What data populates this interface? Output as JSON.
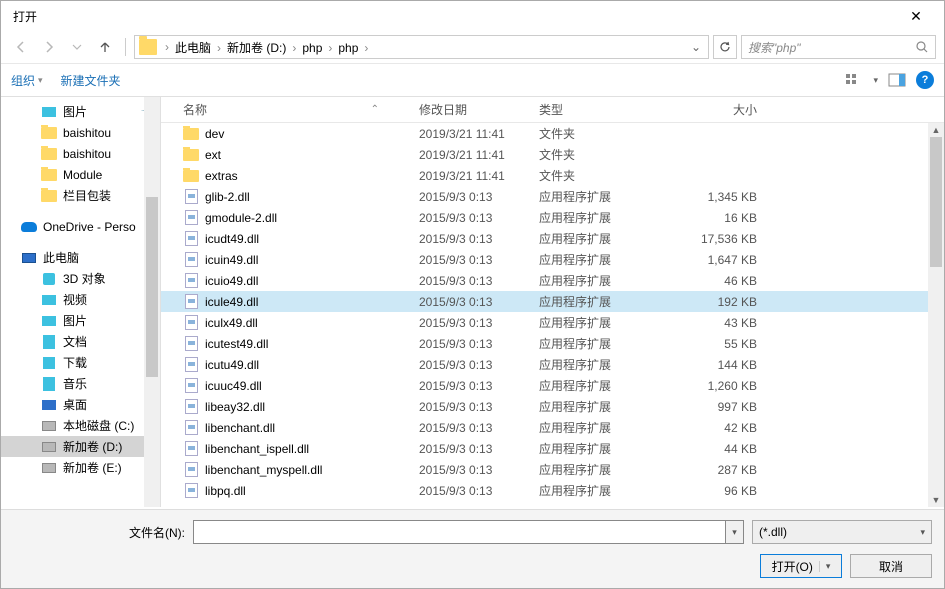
{
  "title": "打开",
  "breadcrumb": [
    "此电脑",
    "新加卷 (D:)",
    "php",
    "php"
  ],
  "search_placeholder": "搜索\"php\"",
  "toolbar": {
    "organize": "组织",
    "new_folder": "新建文件夹"
  },
  "sidebar": [
    {
      "icon": "pic",
      "label": "图片",
      "level": 2,
      "pin": true
    },
    {
      "icon": "folder",
      "label": "baishitou",
      "level": 2
    },
    {
      "icon": "folder",
      "label": "baishitou",
      "level": 2
    },
    {
      "icon": "folder",
      "label": "Module",
      "level": 2
    },
    {
      "icon": "folder",
      "label": "栏目包装",
      "level": 2
    },
    {
      "spacer": true
    },
    {
      "icon": "onedrive",
      "label": "OneDrive - Perso",
      "level": 1
    },
    {
      "spacer": true
    },
    {
      "icon": "pc",
      "label": "此电脑",
      "level": 1
    },
    {
      "icon": "3d",
      "label": "3D 对象",
      "level": 2
    },
    {
      "icon": "video",
      "label": "视频",
      "level": 2
    },
    {
      "icon": "pic",
      "label": "图片",
      "level": 2
    },
    {
      "icon": "doc",
      "label": "文档",
      "level": 2
    },
    {
      "icon": "down",
      "label": "下载",
      "level": 2
    },
    {
      "icon": "music",
      "label": "音乐",
      "level": 2
    },
    {
      "icon": "desktop",
      "label": "桌面",
      "level": 2
    },
    {
      "icon": "disk",
      "label": "本地磁盘 (C:)",
      "level": 2
    },
    {
      "icon": "disk",
      "label": "新加卷 (D:)",
      "level": 2,
      "selected": true
    },
    {
      "icon": "disk",
      "label": "新加卷 (E:)",
      "level": 2
    }
  ],
  "columns": {
    "name": "名称",
    "date": "修改日期",
    "type": "类型",
    "size": "大小"
  },
  "files": [
    {
      "icon": "folder",
      "name": "dev",
      "date": "2019/3/21 11:41",
      "type": "文件夹",
      "size": ""
    },
    {
      "icon": "folder",
      "name": "ext",
      "date": "2019/3/21 11:41",
      "type": "文件夹",
      "size": ""
    },
    {
      "icon": "folder",
      "name": "extras",
      "date": "2019/3/21 11:41",
      "type": "文件夹",
      "size": ""
    },
    {
      "icon": "dll",
      "name": "glib-2.dll",
      "date": "2015/9/3 0:13",
      "type": "应用程序扩展",
      "size": "1,345 KB"
    },
    {
      "icon": "dll",
      "name": "gmodule-2.dll",
      "date": "2015/9/3 0:13",
      "type": "应用程序扩展",
      "size": "16 KB"
    },
    {
      "icon": "dll",
      "name": "icudt49.dll",
      "date": "2015/9/3 0:13",
      "type": "应用程序扩展",
      "size": "17,536 KB"
    },
    {
      "icon": "dll",
      "name": "icuin49.dll",
      "date": "2015/9/3 0:13",
      "type": "应用程序扩展",
      "size": "1,647 KB"
    },
    {
      "icon": "dll",
      "name": "icuio49.dll",
      "date": "2015/9/3 0:13",
      "type": "应用程序扩展",
      "size": "46 KB"
    },
    {
      "icon": "dll",
      "name": "icule49.dll",
      "date": "2015/9/3 0:13",
      "type": "应用程序扩展",
      "size": "192 KB",
      "selected": true
    },
    {
      "icon": "dll",
      "name": "iculx49.dll",
      "date": "2015/9/3 0:13",
      "type": "应用程序扩展",
      "size": "43 KB"
    },
    {
      "icon": "dll",
      "name": "icutest49.dll",
      "date": "2015/9/3 0:13",
      "type": "应用程序扩展",
      "size": "55 KB"
    },
    {
      "icon": "dll",
      "name": "icutu49.dll",
      "date": "2015/9/3 0:13",
      "type": "应用程序扩展",
      "size": "144 KB"
    },
    {
      "icon": "dll",
      "name": "icuuc49.dll",
      "date": "2015/9/3 0:13",
      "type": "应用程序扩展",
      "size": "1,260 KB"
    },
    {
      "icon": "dll",
      "name": "libeay32.dll",
      "date": "2015/9/3 0:13",
      "type": "应用程序扩展",
      "size": "997 KB"
    },
    {
      "icon": "dll",
      "name": "libenchant.dll",
      "date": "2015/9/3 0:13",
      "type": "应用程序扩展",
      "size": "42 KB"
    },
    {
      "icon": "dll",
      "name": "libenchant_ispell.dll",
      "date": "2015/9/3 0:13",
      "type": "应用程序扩展",
      "size": "44 KB"
    },
    {
      "icon": "dll",
      "name": "libenchant_myspell.dll",
      "date": "2015/9/3 0:13",
      "type": "应用程序扩展",
      "size": "287 KB"
    },
    {
      "icon": "dll",
      "name": "libpq.dll",
      "date": "2015/9/3 0:13",
      "type": "应用程序扩展",
      "size": "96 KB"
    }
  ],
  "footer": {
    "filename_label": "文件名(N):",
    "filename_value": "",
    "filter": "(*.dll)",
    "open": "打开(O)",
    "cancel": "取消"
  }
}
